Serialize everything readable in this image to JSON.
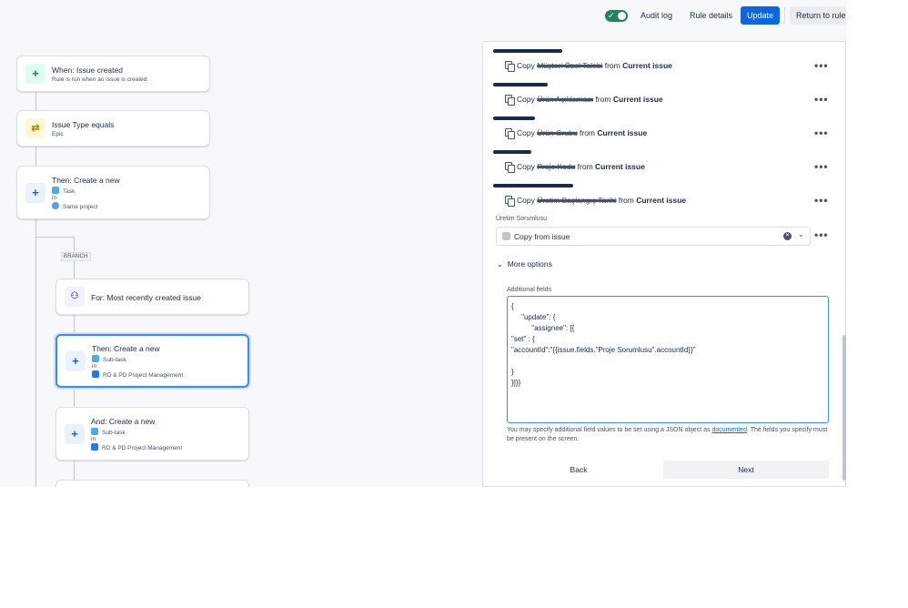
{
  "topbar": {
    "toggle_state": "on",
    "audit_log": "Audit log",
    "rule_details": "Rule details",
    "update": "Update",
    "return_to_rules": "Return to rule"
  },
  "flow": {
    "trigger": {
      "title": "When: Issue created",
      "subtitle": "Rule is run when an issue is created."
    },
    "condition": {
      "title": "Issue Type equals",
      "subtitle": "Epic"
    },
    "action_create": {
      "title": "Then: Create a new",
      "type": "Task",
      "in": "in",
      "project": "Same project"
    },
    "branch_tag": "BRANCH",
    "branch": {
      "title": "For: Most recently created issue"
    },
    "branch_action_1": {
      "title": "Then: Create a new",
      "type": "Sub-task",
      "in": "in",
      "project": "RD & PD Project Management"
    },
    "branch_action_2": {
      "title": "And: Create a new",
      "type": "Sub-task",
      "in": "in",
      "project": "RD & PD Project Management"
    }
  },
  "panel": {
    "copy_rows": [
      {
        "copy": "Copy",
        "field": "Müşteri Özel Talebi",
        "from": "from",
        "source": "Current issue"
      },
      {
        "copy": "Copy",
        "field": "Ürün Açıklaması",
        "from": "from",
        "source": "Current issue"
      },
      {
        "copy": "Copy",
        "field": "Ürün Grubu",
        "from": "from",
        "source": "Current issue"
      },
      {
        "copy": "Copy",
        "field": "Proje Kodu",
        "from": "from",
        "source": "Current issue"
      },
      {
        "copy": "Copy",
        "field": "Üretim Başlangıç Tarihi",
        "from": "from",
        "source": "Current issue"
      }
    ],
    "uretim_label": "Üretim Sorumlusu",
    "select_value": "Copy from issue",
    "more_options": "More options",
    "additional_fields_label": "Additional fields",
    "additional_fields_value": "{\n     \"update\": {\n          \"assignee\": [{\n\"set\" : {\n\"accountId\":\"{{issue.fields.\"Proje Sorumlusu\".accountId}}\"\n\n}\n}]}}",
    "help_prefix": "You may specify additional field values to be set using a JSON object as ",
    "help_link": "documented",
    "help_suffix": ". The fields you specify must be present on the screen.",
    "back": "Back",
    "next": "Next"
  },
  "colors": {
    "primary": "#0c66e4",
    "toggle_on": "#1f845a",
    "focus": "#388bff"
  },
  "icons": [
    "check-icon",
    "plus-icon",
    "shuffle-icon",
    "branch-icon",
    "copy-icon",
    "more-icon",
    "clear-icon",
    "chevron-down-icon",
    "chevron-icon"
  ]
}
